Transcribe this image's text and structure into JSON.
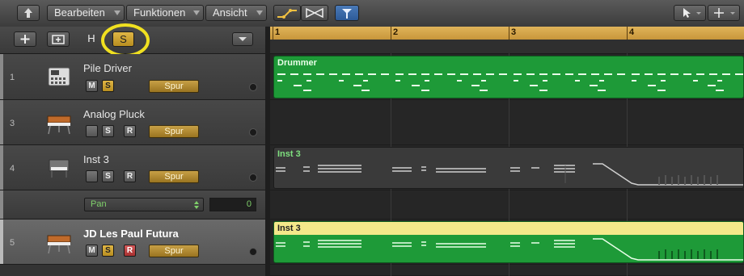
{
  "toolbar": {
    "menus": [
      "Bearbeiten",
      "Funktionen",
      "Ansicht"
    ]
  },
  "header": {
    "hide_label": "H",
    "solo_label": "S"
  },
  "ruler": {
    "bars": [
      "1",
      "2",
      "3",
      "4"
    ]
  },
  "tracks": [
    {
      "num": "1",
      "name": "Pile Driver",
      "buttons": [
        "M",
        "S"
      ],
      "spur": "Spur",
      "icon": "drum-machine-icon"
    },
    {
      "num": "3",
      "name": "Analog Pluck",
      "buttons": [
        "",
        "S",
        "R"
      ],
      "spur": "Spur",
      "icon": "synth-keyboard-icon"
    },
    {
      "num": "4",
      "name": "Inst 3",
      "buttons": [
        "",
        "S",
        "R"
      ],
      "spur": "Spur",
      "icon": "piano-icon"
    },
    {
      "num": "5",
      "name": "JD Les Paul Futura",
      "buttons": [
        "M",
        "S",
        "R"
      ],
      "spur": "Spur",
      "icon": "synth-keyboard-icon"
    }
  ],
  "automation": {
    "param": "Pan",
    "value": "0"
  },
  "regions": [
    {
      "label": "Drummer",
      "color": "#1e9a38"
    },
    {
      "label": "Inst 3",
      "color": "#3a3a3a"
    },
    {
      "label": "Inst 3",
      "color": "#1e9a38",
      "header_color": "#f4e88a"
    }
  ],
  "colors": {
    "accent_yellow": "#c8963a",
    "highlight_circle": "#f0e020"
  }
}
